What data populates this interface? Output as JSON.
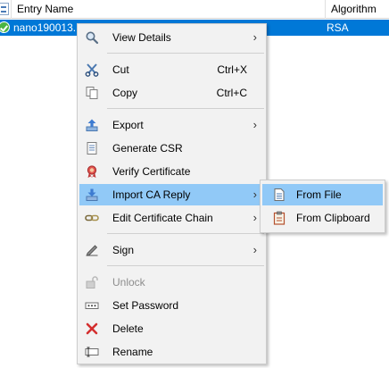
{
  "table": {
    "columns": {
      "entry_name": "Entry Name",
      "algorithm": "Algorithm"
    },
    "selected_row": {
      "entry_name": "nano190013.b",
      "algorithm": "RSA"
    }
  },
  "context_menu": {
    "view_details": {
      "label": "View Details",
      "icon": "magnifier-icon"
    },
    "cut": {
      "label": "Cut",
      "shortcut": "Ctrl+X",
      "icon": "scissors-icon"
    },
    "copy": {
      "label": "Copy",
      "shortcut": "Ctrl+C",
      "icon": "copy-icon"
    },
    "export": {
      "label": "Export",
      "icon": "export-icon"
    },
    "generate_csr": {
      "label": "Generate CSR",
      "icon": "csr-document-icon"
    },
    "verify_certificate": {
      "label": "Verify Certificate",
      "icon": "certificate-ribbon-icon"
    },
    "import_ca_reply": {
      "label": "Import CA Reply",
      "icon": "import-icon",
      "highlighted": true
    },
    "edit_certificate_chain": {
      "label": "Edit Certificate Chain",
      "icon": "chain-icon"
    },
    "sign": {
      "label": "Sign",
      "icon": "pen-sign-icon"
    },
    "unlock": {
      "label": "Unlock",
      "icon": "padlock-open-icon",
      "disabled": true
    },
    "set_password": {
      "label": "Set Password",
      "icon": "password-field-icon"
    },
    "delete": {
      "label": "Delete",
      "icon": "red-x-icon"
    },
    "rename": {
      "label": "Rename",
      "icon": "rename-field-icon"
    }
  },
  "submenu": {
    "from_file": {
      "label": "From File",
      "icon": "file-icon",
      "highlighted": true
    },
    "from_clipboard": {
      "label": "From Clipboard",
      "icon": "clipboard-icon"
    }
  },
  "colors": {
    "selection": "#0078d7",
    "menu_highlight": "#91c9f7",
    "menu_background": "#f2f2f2"
  }
}
